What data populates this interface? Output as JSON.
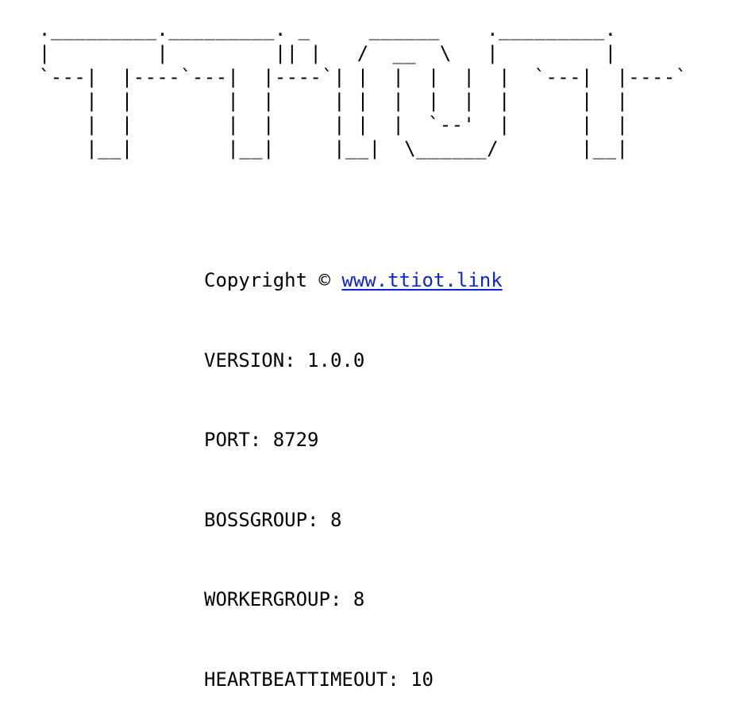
{
  "banner": {
    "ascii_art": " ._________._________. _     ______    ._________.\n |         |         || |   /  __  \\   |         |\n `---|  |----`---|  |----`| |  |  |  |  |  `---|  |----`\n     |  |        |  |     | |  |  |  |  |      |  |\n     |  |        |  |     | |  |  `--'  |      |  |\n     |__|        |__|     |__|  \\______/       |__|"
  },
  "info": {
    "copyright_label": "Copyright © ",
    "copyright_link": "www.ttiot.link",
    "version_label": "VERSION: ",
    "version_value": "1.0.0",
    "port_label": "PORT: ",
    "port_value": "8729",
    "bossgroup_label": "BOSSGROUP: ",
    "bossgroup_value": "8",
    "workergroup_label": "WORKERGROUP: ",
    "workergroup_value": "8",
    "heartbeat_label": "HEARTBEATTIMEOUT: ",
    "heartbeat_value": "10"
  },
  "colors": {
    "text": "#000000",
    "link": "#0b24e0",
    "background": "#ffffff"
  }
}
